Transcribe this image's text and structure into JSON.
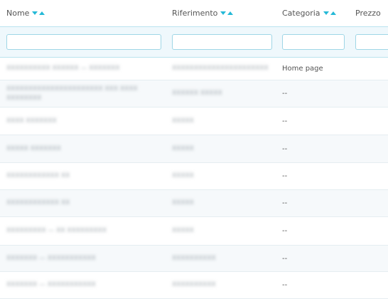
{
  "table": {
    "columns": [
      {
        "key": "nome",
        "label": "Nome"
      },
      {
        "key": "riferimento",
        "label": "Riferimento"
      },
      {
        "key": "categoria",
        "label": "Categoria"
      },
      {
        "key": "prezzo",
        "label": "Prezzo"
      }
    ],
    "filters": {
      "nome": "",
      "riferimento": "",
      "categoria": "",
      "prezzo": ""
    },
    "rows": [
      {
        "nome": "XXXXXXXXXX XXXXXX — XXXXXXX",
        "riferimento": "XXXXXXXXXXXXXXXXXXXXXX",
        "categoria": "Home page"
      },
      {
        "nome": "XXXXXXXXXXXXXXXXXXXXXX XXX XXXX XXXXXXXX",
        "riferimento": "XXXXXX XXXXX",
        "categoria": "--"
      },
      {
        "nome": "XXXX XXXXXXX",
        "riferimento": "XXXXX",
        "categoria": "--"
      },
      {
        "nome": "XXXXX XXXXXXX",
        "riferimento": "XXXXX",
        "categoria": "--"
      },
      {
        "nome": "XXXXXXXXXXXX XX",
        "riferimento": "XXXXX",
        "categoria": "--"
      },
      {
        "nome": "XXXXXXXXXXXX XX",
        "riferimento": "XXXXX",
        "categoria": "--"
      },
      {
        "nome": "XXXXXXXXX — XX XXXXXXXXX",
        "riferimento": "XXXXX",
        "categoria": "--"
      },
      {
        "nome": "XXXXXXX — XXXXXXXXXXX",
        "riferimento": "XXXXXXXXXX",
        "categoria": "--"
      },
      {
        "nome": "XXXXXXX — XXXXXXXXXXX",
        "riferimento": "XXXXXXXXXX",
        "categoria": "--"
      }
    ]
  }
}
